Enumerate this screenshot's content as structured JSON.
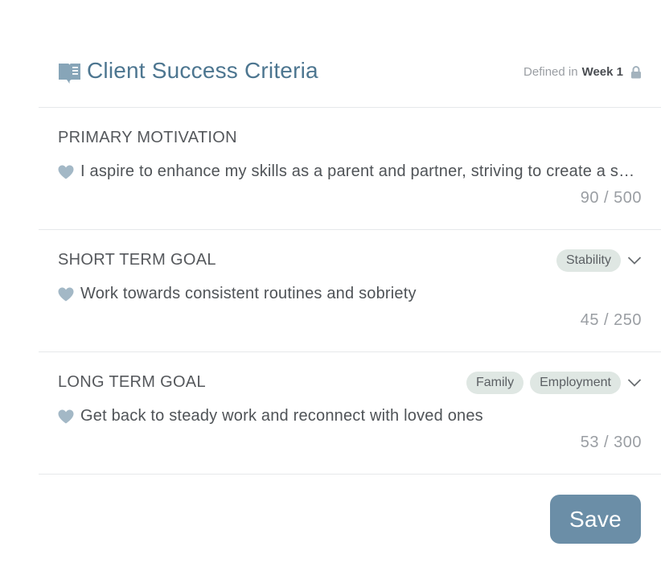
{
  "header": {
    "title": "Client Success Criteria",
    "defined_prefix": "Defined in",
    "defined_week": "Week 1",
    "icon": "book-icon",
    "lock_icon": "lock-icon"
  },
  "sections": [
    {
      "label": "PRIMARY MOTIVATION",
      "text": "I aspire to enhance my skills as a parent and partner, striving to create a supportive home",
      "count": "90 / 500",
      "tags": []
    },
    {
      "label": "SHORT TERM GOAL",
      "text": "Work towards consistent routines and sobriety",
      "count": "45 / 250",
      "tags": [
        "Stability"
      ]
    },
    {
      "label": "LONG TERM GOAL",
      "text": "Get back to steady work and reconnect with loved ones",
      "count": "53 / 300",
      "tags": [
        "Family",
        "Employment"
      ]
    }
  ],
  "actions": {
    "save_label": "Save"
  },
  "colors": {
    "accent": "#4d7690",
    "button": "#6b8ea7",
    "tag_bg": "#dfe7e3",
    "heart": "#a3b8c6"
  }
}
